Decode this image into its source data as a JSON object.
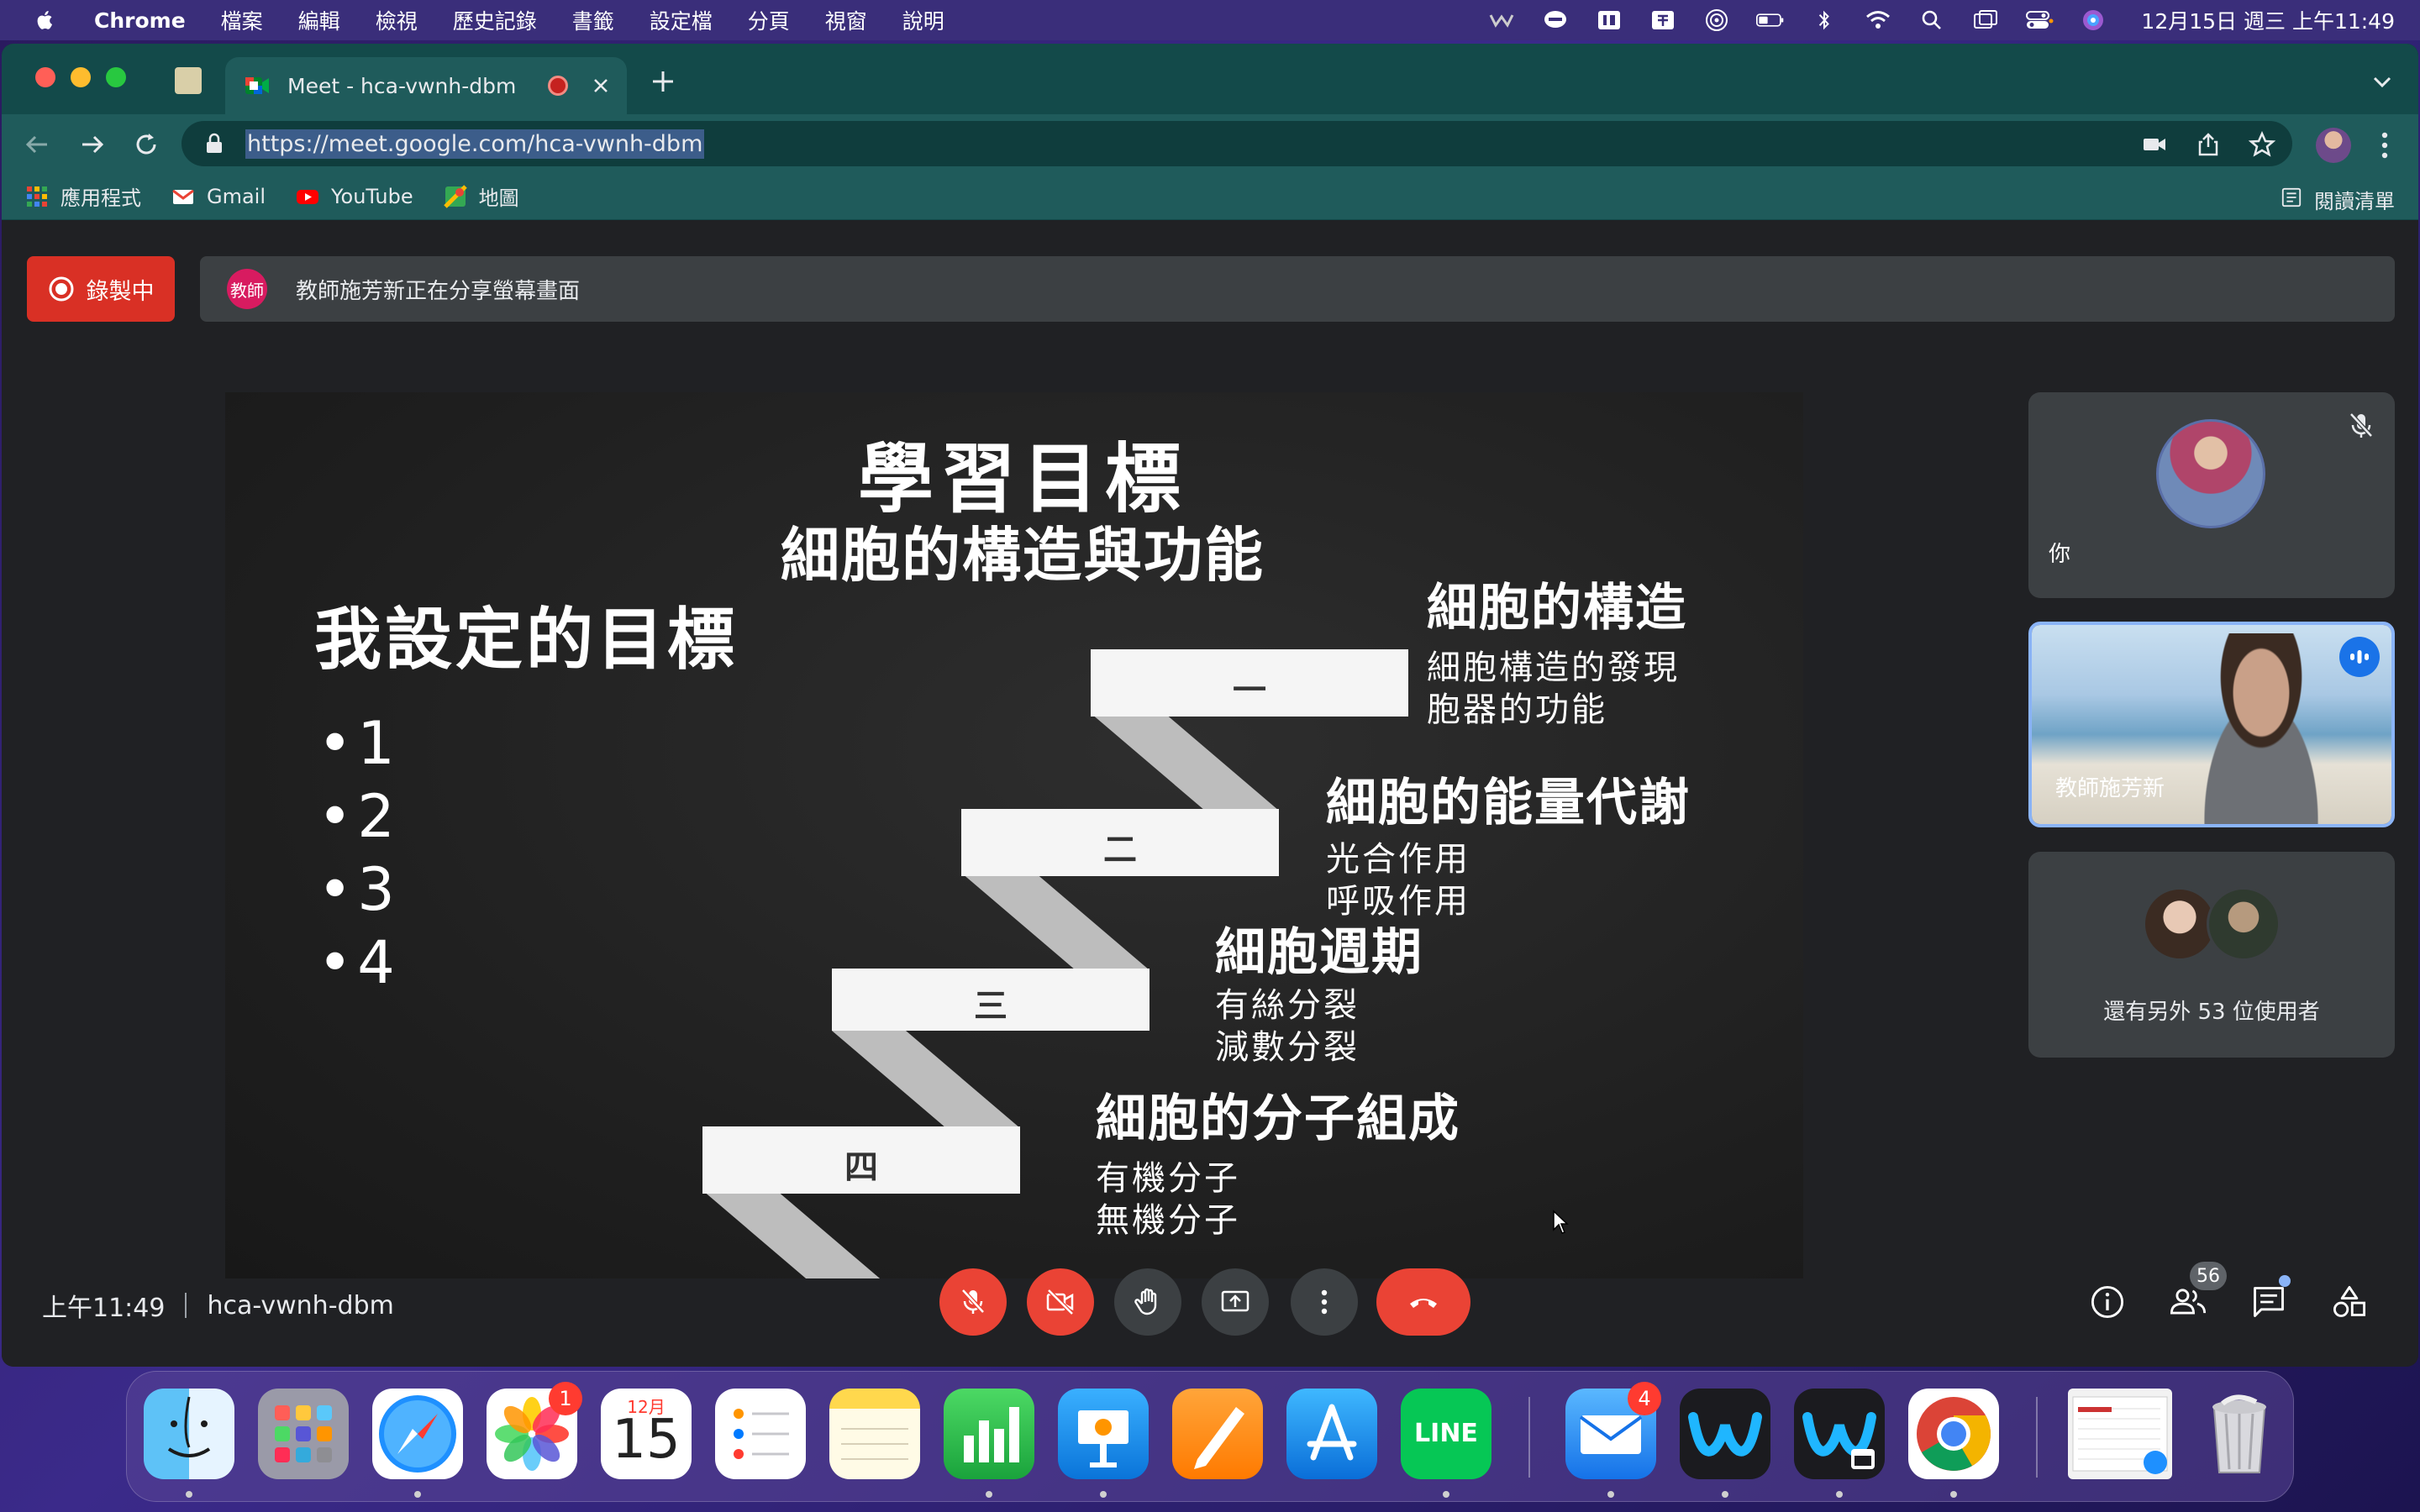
{
  "menubar": {
    "app": "Chrome",
    "items": [
      "檔案",
      "編輯",
      "檢視",
      "歷史記錄",
      "書籤",
      "設定檔",
      "分頁",
      "視窗",
      "說明"
    ],
    "clock": "12月15日 週三 上午11:49"
  },
  "browser": {
    "tab_title": "Meet - hca-vwnh-dbm",
    "url": "https://meet.google.com/hca-vwnh-dbm",
    "bookmarks": [
      "應用程式",
      "Gmail",
      "YouTube",
      "地圖"
    ],
    "reading_list": "閱讀清單"
  },
  "meet": {
    "recording_label": "錄製中",
    "presenter_avatar": "教師",
    "share_banner": "教師施芳新正在分享螢幕畫面",
    "slide": {
      "title": "學習目標",
      "subtitle": "細胞的構造與功能",
      "goal_heading": "我設定的目標",
      "bullets": [
        "1",
        "2",
        "3",
        "4"
      ],
      "steps": [
        "一",
        "二",
        "三",
        "四"
      ],
      "topics": [
        {
          "heading": "細胞的構造",
          "items": [
            "細胞構造的發現",
            "胞器的功能"
          ]
        },
        {
          "heading": "細胞的能量代謝",
          "items": [
            "光合作用",
            "呼吸作用"
          ]
        },
        {
          "heading": "細胞週期",
          "items": [
            "有絲分裂",
            "減數分裂"
          ]
        },
        {
          "heading": "細胞的分子組成",
          "items": [
            "有機分子",
            "無機分子"
          ]
        }
      ]
    },
    "participants": {
      "you": "你",
      "teacher": "教師施芳新",
      "others": "還有另外 53 位使用者"
    },
    "bottom": {
      "time": "上午11:49",
      "code": "hca-vwnh-dbm",
      "people_count": "56"
    }
  },
  "dock": {
    "photos_badge": "1",
    "calendar_month": "12月",
    "calendar_day": "15",
    "line_label": "LINE",
    "mail_badge": "4"
  }
}
